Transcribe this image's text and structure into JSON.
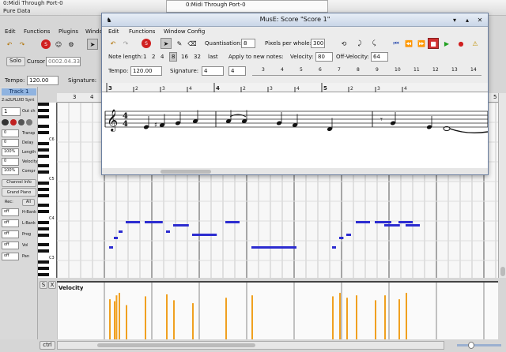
{
  "background_window": {
    "title_lines": [
      "0:Midi Through Port-0",
      "Pure Data"
    ],
    "menu": [
      "Edit",
      "Functions",
      "Plugins",
      "Window"
    ],
    "solo_label": "Solo",
    "cursor_label": "Cursor",
    "cursor_value": "0002.04.336",
    "tempo_label": "Tempo:",
    "tempo_value": "120.00",
    "signature_label": "Signature:",
    "track_name": "Track 1",
    "port_label": "2:a2LPLUID Synt",
    "channel_value": "1",
    "out_ch_label": "Out ch",
    "strip_rows": [
      {
        "value": "0",
        "label": "Transp"
      },
      {
        "value": "0",
        "label": "Delay"
      },
      {
        "value": "100%",
        "label": "Length"
      },
      {
        "value": "0",
        "label": "Velocity"
      },
      {
        "value": "100%",
        "label": "Compr"
      }
    ],
    "channel_info_label": "Channel Info",
    "instrument_button": "Grand Piano",
    "rec_label": "Rec:",
    "all_label": "All",
    "ctrl_rows": [
      {
        "value": "off",
        "label": "H-Bank"
      },
      {
        "value": "off",
        "label": "L-Bank"
      },
      {
        "value": "off",
        "label": "Prog"
      },
      {
        "value": "off",
        "label": "Vol"
      },
      {
        "value": "off",
        "label": "Pan"
      }
    ],
    "octave_labels": [
      "C6",
      "C5",
      "C4",
      "C3"
    ],
    "ruler_marks": [
      "3",
      "4",
      "5"
    ],
    "s_button": "S",
    "x_button": "X",
    "velocity_label": "Velocity",
    "ctrl_button": "ctrl",
    "top_list_item": "0:Midi Through Port-0",
    "notes": [
      {
        "bar": 2.1,
        "len": 0.08,
        "pitch": 0
      },
      {
        "bar": 2.2,
        "len": 0.08,
        "pitch": 3
      },
      {
        "bar": 2.3,
        "len": 0.08,
        "pitch": 5
      },
      {
        "bar": 2.45,
        "len": 0.3,
        "pitch": 8
      },
      {
        "bar": 2.85,
        "len": 0.38,
        "pitch": 8
      },
      {
        "bar": 3.3,
        "len": 0.08,
        "pitch": 5
      },
      {
        "bar": 3.45,
        "len": 0.33,
        "pitch": 7
      },
      {
        "bar": 3.85,
        "len": 0.52,
        "pitch": 4
      },
      {
        "bar": 4.55,
        "len": 0.3,
        "pitch": 8
      },
      {
        "bar": 5.1,
        "len": 0.95,
        "pitch": 0
      },
      {
        "bar": 6.8,
        "len": 0.07,
        "pitch": 0
      },
      {
        "bar": 6.95,
        "len": 0.09,
        "pitch": 3
      },
      {
        "bar": 7.1,
        "len": 0.1,
        "pitch": 4
      },
      {
        "bar": 7.3,
        "len": 0.3,
        "pitch": 8
      },
      {
        "bar": 7.7,
        "len": 0.35,
        "pitch": 8
      },
      {
        "bar": 7.9,
        "len": 0.33,
        "pitch": 7
      },
      {
        "bar": 8.2,
        "len": 0.3,
        "pitch": 8
      },
      {
        "bar": 8.35,
        "len": 0.3,
        "pitch": 7
      }
    ],
    "velocities": [
      {
        "bar": 2.1,
        "v": 0.82
      },
      {
        "bar": 2.2,
        "v": 0.78
      },
      {
        "bar": 2.24,
        "v": 0.9
      },
      {
        "bar": 2.3,
        "v": 0.95
      },
      {
        "bar": 2.45,
        "v": 0.7
      },
      {
        "bar": 2.85,
        "v": 0.88
      },
      {
        "bar": 3.3,
        "v": 0.92
      },
      {
        "bar": 3.45,
        "v": 0.8
      },
      {
        "bar": 3.85,
        "v": 0.74
      },
      {
        "bar": 4.55,
        "v": 0.85
      },
      {
        "bar": 5.1,
        "v": 0.9
      },
      {
        "bar": 6.8,
        "v": 0.88
      },
      {
        "bar": 6.95,
        "v": 0.95
      },
      {
        "bar": 7.1,
        "v": 0.85
      },
      {
        "bar": 7.3,
        "v": 0.9
      },
      {
        "bar": 7.7,
        "v": 0.8
      },
      {
        "bar": 7.9,
        "v": 0.9
      },
      {
        "bar": 8.2,
        "v": 0.82
      },
      {
        "bar": 8.35,
        "v": 0.95
      }
    ]
  },
  "score_window": {
    "title": "MusE: Score \"Score 1\"",
    "menu": [
      "Edit",
      "Functions",
      "Window Config"
    ],
    "quantisation_label": "Quantisation:",
    "quantisation_value": "8",
    "ppw_label": "Pixels per whole:",
    "ppw_value": "300",
    "note_length_label": "Note length:",
    "note_lengths": [
      "1",
      "2",
      "4",
      "8",
      "16",
      "32",
      "last"
    ],
    "selected_note_length": "8",
    "apply_label": "Apply to new notes:",
    "velocity_label": "Velocity:",
    "velocity_value": "80",
    "off_velocity_label": "Off-Velocity:",
    "off_velocity_value": "64",
    "tempo_label": "Tempo:",
    "tempo_value": "120.00",
    "signature_label": "Signature:",
    "sig_num": "4",
    "sig_den": "4",
    "ruler_marks": [
      "3",
      "|2",
      "|3",
      "|4",
      "4",
      "|2",
      "|3",
      "|4",
      "5",
      "|2",
      "|3",
      "|4"
    ],
    "ruler_numbers": [
      "3",
      "4",
      "5",
      "6",
      "7",
      "8",
      "9",
      "10",
      "11",
      "12",
      "13",
      "14"
    ],
    "time_signature": [
      "4",
      "4"
    ],
    "clef": "treble",
    "colors": {
      "note": "#2c2cd0",
      "velocity": "#f0a020",
      "accent": "#2244aa"
    }
  }
}
